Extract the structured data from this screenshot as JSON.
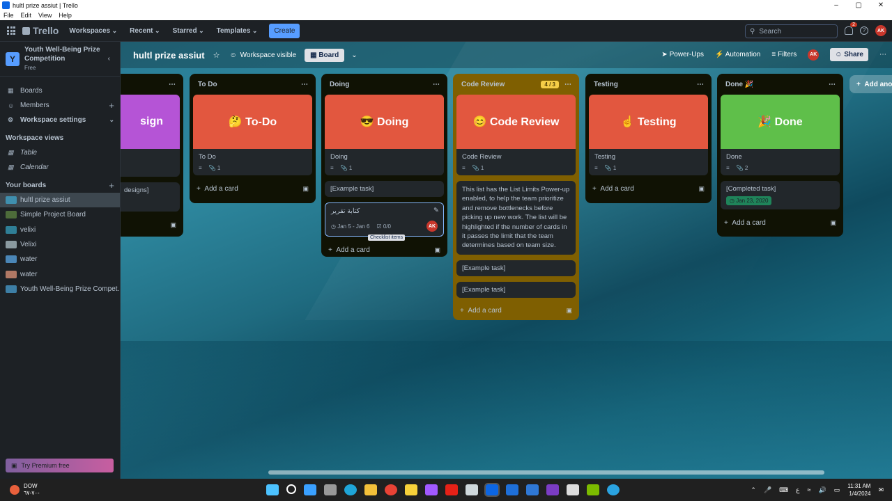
{
  "window": {
    "title": "hultl prize assiut | Trello",
    "menu": [
      "File",
      "Edit",
      "View",
      "Help"
    ]
  },
  "topnav": {
    "logo": "Trello",
    "menus": [
      "Workspaces",
      "Recent",
      "Starred",
      "Templates"
    ],
    "create_label": "Create",
    "search_placeholder": "Search",
    "notification_count": "2",
    "avatar_initials": "AK"
  },
  "sidebar": {
    "workspace_initial": "Y",
    "workspace_name": "Youth Well-Being Prize Competition",
    "workspace_plan": "Free",
    "nav": [
      {
        "label": "Boards",
        "icon": "board-icon"
      },
      {
        "label": "Members",
        "icon": "members-icon"
      },
      {
        "label": "Workspace settings",
        "icon": "gear-icon"
      }
    ],
    "views_heading": "Workspace views",
    "views": [
      {
        "label": "Table"
      },
      {
        "label": "Calendar"
      }
    ],
    "boards_heading": "Your boards",
    "boards": [
      {
        "label": "hultl prize assiut",
        "color": "#3f8fae"
      },
      {
        "label": "Simple Project Board",
        "color": "#4d6b3a"
      },
      {
        "label": "velixi",
        "color": "#2f7f97"
      },
      {
        "label": "Velixi",
        "color": "#8a9aa0"
      },
      {
        "label": "water",
        "color": "#4a86b7"
      },
      {
        "label": "water",
        "color": "#b07864"
      },
      {
        "label": "Youth Well-Being Prize Compet...",
        "color": "#3d7fa6"
      }
    ],
    "premium_label": "Try Premium free"
  },
  "board": {
    "title": "hultl prize assiut",
    "visibility": "Workspace visible",
    "view": "Board",
    "power_ups": "Power-Ups",
    "automation": "Automation",
    "filters": "Filters",
    "share": "Share",
    "add_another": "Add ano",
    "lists": {
      "design": {
        "cover_text": "sign",
        "task": "designs]",
        "cover_color": "#b554d6"
      },
      "todo": {
        "name": "To Do",
        "cover_text": "🤔 To-Do",
        "card_title": "To Do",
        "attach_count": "1",
        "add_card": "Add a card",
        "cover_color": "#e2573f"
      },
      "doing": {
        "name": "Doing",
        "cover_text": "😎 Doing",
        "card_title": "Doing",
        "attach_count": "1",
        "task": "[Example task]",
        "arabic_card": "كتابة تقرير",
        "dates": "Jan 5 - Jan 6",
        "checklist": "0/0",
        "tooltip": "Checklist items",
        "member": "AK",
        "add_card": "Add a card",
        "cover_color": "#e2573f"
      },
      "review": {
        "name": "Code Review",
        "limit": "4 / 3",
        "cover_text": "😊 Code Review",
        "card_title": "Code Review",
        "attach_count": "1",
        "description": "This list has the List Limits Power-up enabled, to help the team prioritize and remove bottlenecks before picking up new work. The list will be highlighted if the number of cards in it passes the limit that the team determines based on team size.",
        "task1": "[Example task]",
        "task2": "[Example task]",
        "add_card": "Add a card",
        "cover_color": "#e2573f"
      },
      "testing": {
        "name": "Testing",
        "cover_text": "☝ Testing",
        "card_title": "Testing",
        "attach_count": "1",
        "add_card": "Add a card",
        "cover_color": "#e2573f"
      },
      "done": {
        "name": "Done 🎉",
        "cover_text": "🎉 Done",
        "card_title": "Done",
        "attach_count": "2",
        "task": "[Completed task]",
        "date": "Jan 23, 2020",
        "add_card": "Add a card",
        "cover_color": "#5fbf4a"
      }
    }
  },
  "taskbar": {
    "weather_title": "DOW",
    "weather_sub": "٧٠-٦٧-",
    "time": "11:31 AM",
    "date": "1/4/2024",
    "lang": "ع"
  }
}
